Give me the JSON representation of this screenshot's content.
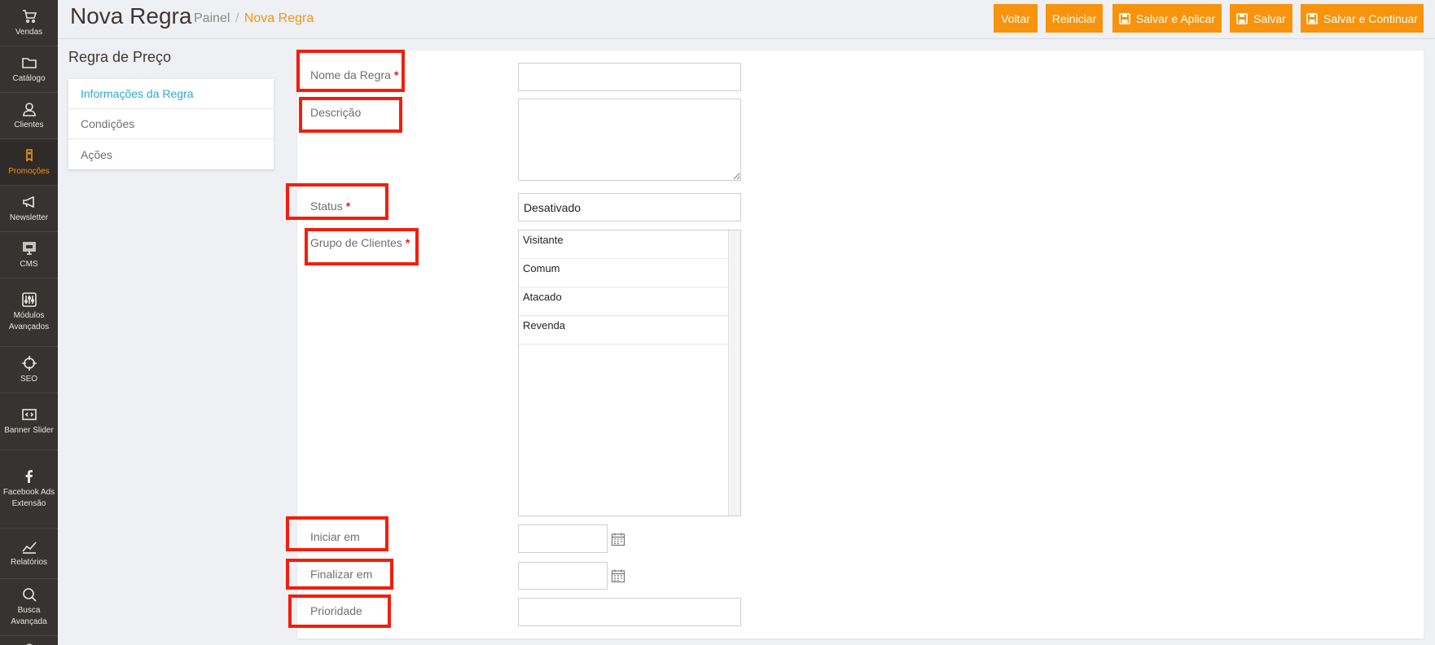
{
  "sidebar": {
    "items": [
      {
        "label": "Vendas",
        "icon": "cart-icon"
      },
      {
        "label": "Catálogo",
        "icon": "folder-icon"
      },
      {
        "label": "Clientes",
        "icon": "user-icon"
      },
      {
        "label": "Promoções",
        "icon": "tag-icon"
      },
      {
        "label": "Newsletter",
        "icon": "megaphone-icon"
      },
      {
        "label": "CMS",
        "icon": "monitor-icon"
      },
      {
        "label": "Módulos Avançados",
        "icon": "sliders-icon"
      },
      {
        "label": "SEO",
        "icon": "crosshair-icon"
      },
      {
        "label": "Banner Slider",
        "icon": "code-icon"
      },
      {
        "label": "Facebook Ads Extensão",
        "icon": "facebook-icon"
      },
      {
        "label": "Relatórios",
        "icon": "chart-icon"
      },
      {
        "label": "Busca Avançada",
        "icon": "search-icon"
      }
    ],
    "active": "Promoções",
    "accent": "#f39414"
  },
  "header": {
    "title": "Nova Regra",
    "breadcrumb": {
      "parent": "Painel",
      "separator": "/",
      "current": "Nova Regra"
    }
  },
  "toolbar": {
    "back_label": "Voltar",
    "reset_label": "Reiniciar",
    "save_apply_label": "Salvar e Aplicar",
    "save_label": "Salvar",
    "save_continue_label": "Salvar e Continuar",
    "button_color": "#f7930c"
  },
  "left_panel": {
    "title": "Regra de Preço",
    "tabs": [
      {
        "label": "Informações da Regra",
        "active": true
      },
      {
        "label": "Condições",
        "active": false
      },
      {
        "label": "Ações",
        "active": false
      }
    ]
  },
  "form": {
    "name": {
      "label": "Nome da Regra",
      "required": "*",
      "value": ""
    },
    "description": {
      "label": "Descrição",
      "value": ""
    },
    "status": {
      "label": "Status",
      "required": "*",
      "value": "Desativado"
    },
    "customer_groups": {
      "label": "Grupo de Clientes",
      "required": "*",
      "options": [
        "Visitante",
        "Comum",
        "Atacado",
        "Revenda"
      ]
    },
    "start": {
      "label": "Iniciar em",
      "value": ""
    },
    "end": {
      "label": "Finalizar em",
      "value": ""
    },
    "priority": {
      "label": "Prioridade",
      "value": ""
    }
  },
  "highlight_color": "#f41d0a"
}
